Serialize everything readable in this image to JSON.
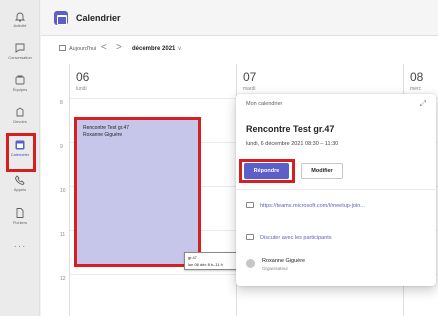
{
  "app": {
    "title": "Calendrier"
  },
  "rail": [
    {
      "label": "Activité",
      "icon": "bell-icon"
    },
    {
      "label": "Conversation",
      "icon": "chat-icon"
    },
    {
      "label": "Équipes",
      "icon": "teams-icon"
    },
    {
      "label": "Devoirs",
      "icon": "assignments-icon"
    },
    {
      "label": "Calendrier",
      "icon": "calendar-icon"
    },
    {
      "label": "Appels",
      "icon": "phone-icon"
    },
    {
      "label": "Fichiers",
      "icon": "file-icon"
    }
  ],
  "rail_more": "···",
  "nav": {
    "today": "Aujourd'hui",
    "prev": "<",
    "next": ">",
    "month": "décembre 2021",
    "month_chevron": "∨"
  },
  "days": [
    {
      "num": "06",
      "name": "lundi"
    },
    {
      "num": "07",
      "name": "mardi"
    },
    {
      "num": "08",
      "name": "merc"
    }
  ],
  "hours": [
    "8",
    "9",
    "10",
    "11",
    "12"
  ],
  "event": {
    "title": "Rencontre Test gr.47",
    "organizer": "Roxanne Giguère"
  },
  "tooltip": {
    "line1": "gr.47",
    "line2": "lun 06 déc 8 h–11 h"
  },
  "popup": {
    "calendar": "Mon calendrier",
    "expand": "⤢",
    "title": "Rencontre Test gr.47",
    "time": "lundi, 6 décembre 2021 08:30 – 11:30",
    "reply": "Répondre",
    "edit": "Modifier",
    "link": "https://teams.microsoft.com/l/meetup-join...",
    "chat": "Discuter avec les participants",
    "organizer_name": "Roxanne Giguère",
    "organizer_role": "Organisateur"
  },
  "colors": {
    "accent": "#5b5fc7",
    "event_fill": "#c5c6ea",
    "highlight": "#d42020"
  }
}
